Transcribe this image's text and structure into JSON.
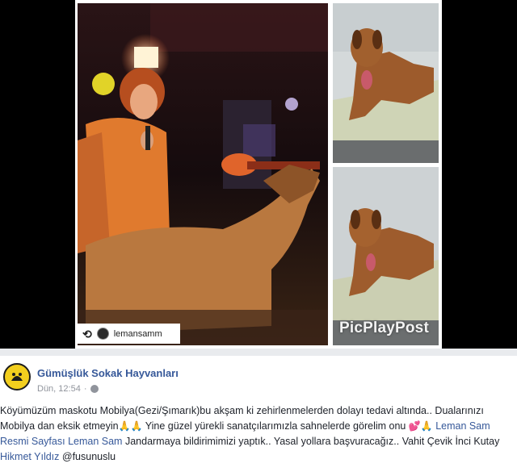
{
  "collage": {
    "repost_user": "lemansamm",
    "repost_icon": "repost-icon",
    "watermark": "PicPlayPost"
  },
  "post": {
    "page_name": "Gümüşlük Sokak Hayvanları",
    "timestamp": "Dün, 12:54",
    "privacy_icon": "globe-icon",
    "text": {
      "t1": "Köyümüzüm maskotu Mobilya(Gezi/Şımarık)bu akşam ki zehirlenmelerden dolayı tedavi altında.. Dualarınızı Mobilya dan eksik etmeyin",
      "e1": "🙏🙏",
      "t2": " Yine güzel yürekli sanatçılarımızla sahnelerde görelim onu ",
      "e2": "💕🙏",
      "link1": "Leman Sam Resmi Sayfası",
      "t3": " ",
      "link2": "Leman Sam",
      "t4": " Jandarmaya bildirimimizi yaptık.. Yasal yollara başvuracağız.. Vahit Çevik İnci Kutay ",
      "link3": "Hikmet Yıldız",
      "t5": " @fusunuslu"
    }
  },
  "colors": {
    "link": "#365899",
    "meta": "#90949c",
    "divider": "#e9ebee",
    "avatar_bg": "#f3cf1e"
  }
}
